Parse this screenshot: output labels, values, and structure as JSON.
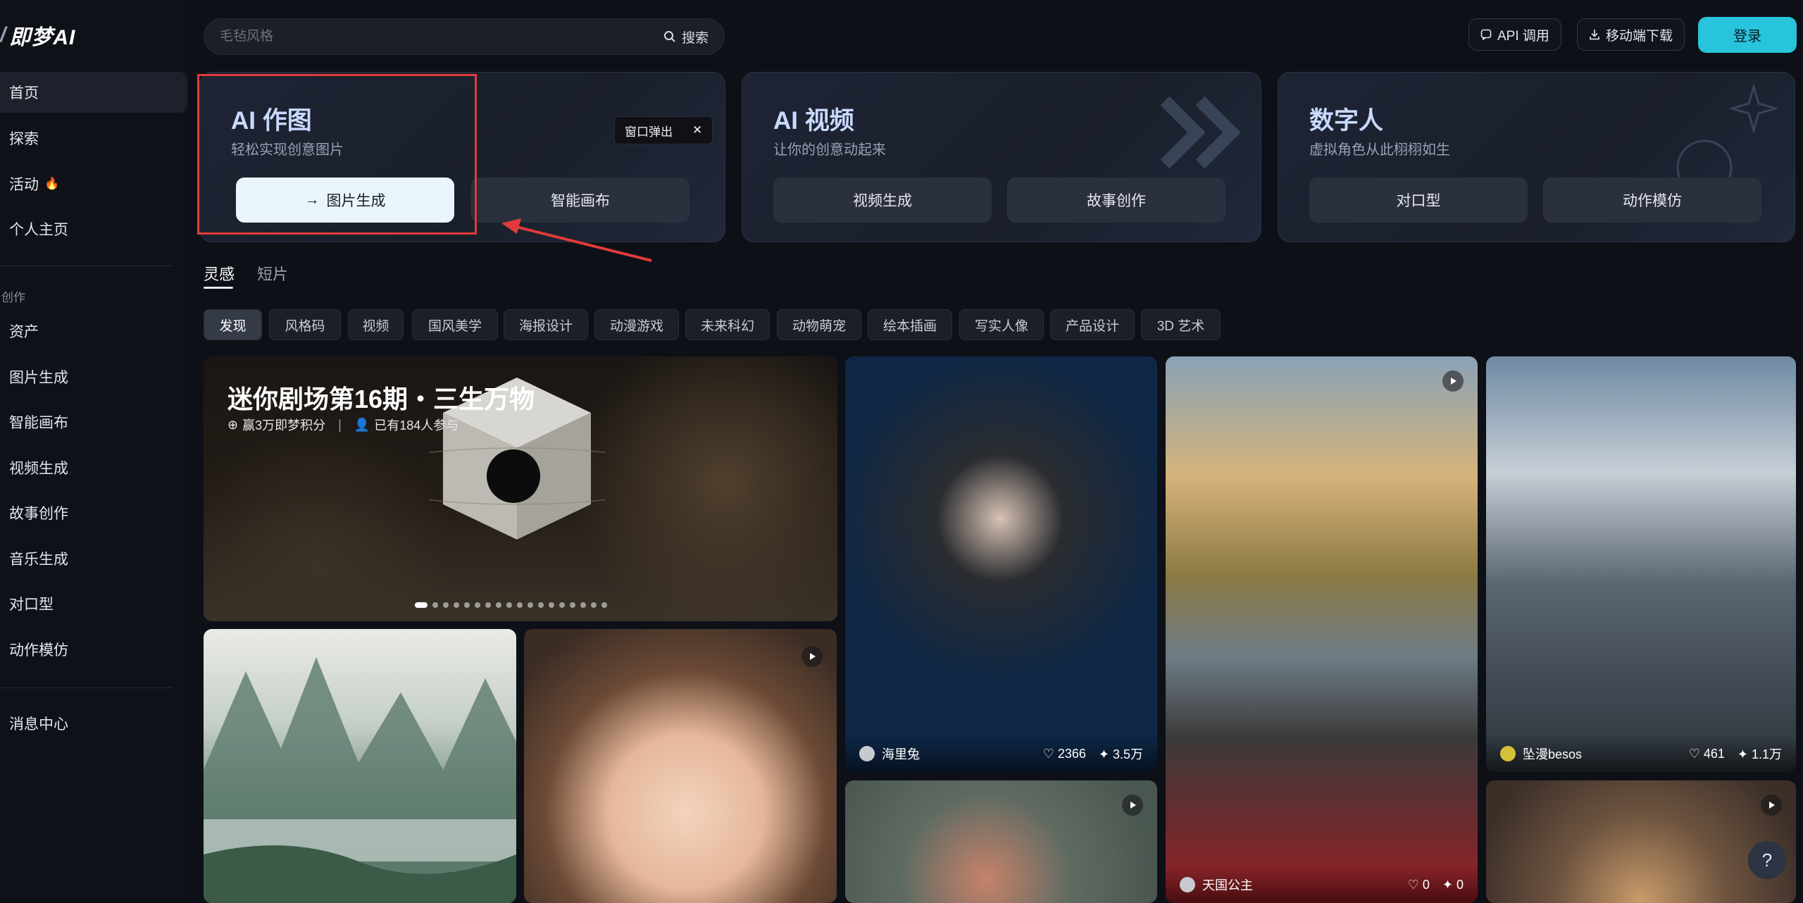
{
  "app": {
    "logo_text": "即梦AI"
  },
  "sidebar": {
    "nav": [
      {
        "label": "首页"
      },
      {
        "label": "探索"
      },
      {
        "label": "活动"
      },
      {
        "label": "个人主页"
      }
    ],
    "section_title": "创作",
    "create_items": [
      {
        "label": "资产"
      },
      {
        "label": "图片生成"
      },
      {
        "label": "智能画布"
      },
      {
        "label": "视频生成"
      },
      {
        "label": "故事创作"
      },
      {
        "label": "音乐生成"
      },
      {
        "label": "对口型"
      },
      {
        "label": "动作模仿"
      }
    ],
    "message_center": "消息中心"
  },
  "header": {
    "search_placeholder": "毛毡风格",
    "search_button": "搜索",
    "api_button": "API 调用",
    "download_button": "移动端下载",
    "login_button": "登录"
  },
  "cards": [
    {
      "title": "AI 作图",
      "subtitle": "轻松实现创意图片",
      "buttons": [
        "图片生成",
        "智能画布"
      ],
      "popup": "窗口弹出"
    },
    {
      "title": "AI 视频",
      "subtitle": "让你的创意动起来",
      "buttons": [
        "视频生成",
        "故事创作"
      ]
    },
    {
      "title": "数字人",
      "subtitle": "虚拟角色从此栩栩如生",
      "buttons": [
        "对口型",
        "动作模仿"
      ]
    }
  ],
  "tabs": [
    "灵感",
    "短片"
  ],
  "chips": [
    "发现",
    "风格码",
    "视频",
    "国风美学",
    "海报设计",
    "动漫游戏",
    "未来科幻",
    "动物萌宠",
    "绘本插画",
    "写实人像",
    "产品设计",
    "3D 艺术"
  ],
  "banner": {
    "title": "迷你剧场第16期・三生万物",
    "reward": "赢3万即梦积分",
    "participants": "已有184人参与",
    "slides": 18,
    "active_slide": 1
  },
  "tiles": [
    {
      "author": "海里兔",
      "likes": "2366",
      "remixes": "3.5万"
    },
    {
      "author": "天国公主",
      "likes": "0",
      "remixes": "0"
    },
    {
      "author": "坠漫besos",
      "likes": "461",
      "remixes": "1.1万"
    }
  ],
  "colors": {
    "accent": "#27c4dc",
    "highlight": "#e23b3b",
    "background": "#0e1017"
  }
}
